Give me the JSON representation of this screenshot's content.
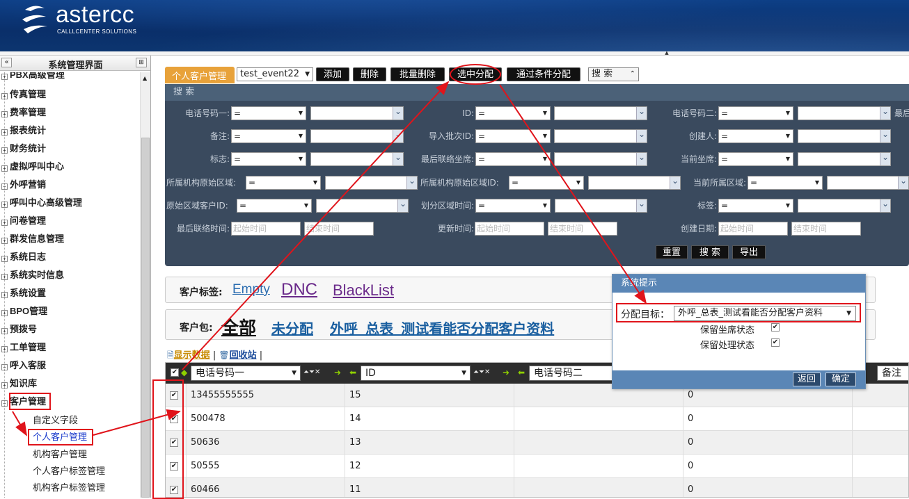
{
  "header": {
    "brand": "astercc",
    "tagline": "CALLLCENTER SOLUTIONS"
  },
  "sidebar": {
    "title": "系统管理界面",
    "items": [
      {
        "label": "PBX高级管理",
        "expander": "+"
      },
      {
        "label": "传真管理",
        "expander": "+"
      },
      {
        "label": "费率管理",
        "expander": "+"
      },
      {
        "label": "报表统计",
        "expander": "+"
      },
      {
        "label": "财务统计",
        "expander": "+"
      },
      {
        "label": "虚拟呼叫中心",
        "expander": "+"
      },
      {
        "label": "外呼营销",
        "expander": "−"
      },
      {
        "label": "呼叫中心高级管理",
        "expander": "+"
      },
      {
        "label": "问卷管理",
        "expander": "+"
      },
      {
        "label": "群发信息管理",
        "expander": "+"
      },
      {
        "label": "系统日志",
        "expander": "+"
      },
      {
        "label": "系统实时信息",
        "expander": "+"
      },
      {
        "label": "系统设置",
        "expander": "+"
      },
      {
        "label": "BPO管理",
        "expander": "+"
      },
      {
        "label": "预拨号",
        "expander": "+"
      },
      {
        "label": "工单管理",
        "expander": "+"
      },
      {
        "label": "呼入客服",
        "expander": "−"
      },
      {
        "label": "知识库",
        "expander": "+"
      },
      {
        "label": "客户管理",
        "expander": "−"
      }
    ],
    "subitems": [
      {
        "label": "自定义字段"
      },
      {
        "label": "个人客户管理"
      },
      {
        "label": "机构客户管理"
      },
      {
        "label": "个人客户标签管理"
      },
      {
        "label": "机构客户标签管理"
      }
    ]
  },
  "toolbar": {
    "tab": "个人客户管理",
    "event_select": "test_event22",
    "add": "添加",
    "delete": "删除",
    "batch_delete": "批量删除",
    "assign_selected": "选中分配",
    "assign_by_condition": "通过条件分配",
    "search_toggle": "搜 索"
  },
  "search": {
    "title": "搜 索",
    "op_default": "=",
    "labels": {
      "phone1": "电话号码一:",
      "id": "ID:",
      "phone2": "电话号码二:",
      "last": "最后",
      "note": "备注:",
      "batch": "导入批次ID:",
      "creator": "创建人:",
      "flag": "标志:",
      "last_agent": "最后联络坐席:",
      "cur_agent": "当前坐席:",
      "org_area": "所属机构原始区域:",
      "org_area_id": "所属机构原始区域ID:",
      "cur_area": "当前所属区域:",
      "orig_client_id": "原始区域客户ID:",
      "area_time": "划分区域时间:",
      "tag": "标签:",
      "last_contact": "最后联络时间:",
      "update_time": "更新时间:",
      "create_date": "创建日期:"
    },
    "start_placeholder": "起始时间",
    "end_placeholder": "结束时间",
    "reset": "重置",
    "search": "搜 索",
    "export": "导出"
  },
  "tags": {
    "label": "客户标签:",
    "items": [
      "Empty",
      "DNC",
      "BlackList"
    ]
  },
  "packages": {
    "label": "客户包:",
    "all": "全部",
    "items": [
      "未分配",
      "外呼_总表_测试看能否分配客户资料"
    ]
  },
  "grid_links": {
    "show": "显示数据",
    "sep": "|",
    "recycle": "回收站"
  },
  "grid": {
    "columns": [
      "电话号码一",
      "ID",
      "电话号码二",
      "备注"
    ],
    "rows": [
      {
        "phone1": "13455555555",
        "id": "15",
        "phone2": "",
        "val": "0"
      },
      {
        "phone1": "500478",
        "id": "14",
        "phone2": "",
        "val": "0"
      },
      {
        "phone1": "50636",
        "id": "13",
        "phone2": "",
        "val": "0"
      },
      {
        "phone1": "50555",
        "id": "12",
        "phone2": "",
        "val": "0"
      },
      {
        "phone1": "60466",
        "id": "11",
        "phone2": "",
        "val": "0"
      }
    ]
  },
  "dialog": {
    "title": "系统提示",
    "target_label": "分配目标：",
    "target_value": "外呼_总表_测试看能否分配客户资料",
    "keep_agent": "保留坐席状态",
    "keep_process": "保留处理状态",
    "back": "返回",
    "ok": "确定"
  },
  "colors": {
    "header": "#0d3f86",
    "search_panel": "#3a4a5e",
    "tab": "#e8a23a",
    "annotation": "#e0141b",
    "dialog": "#5a86b6"
  }
}
